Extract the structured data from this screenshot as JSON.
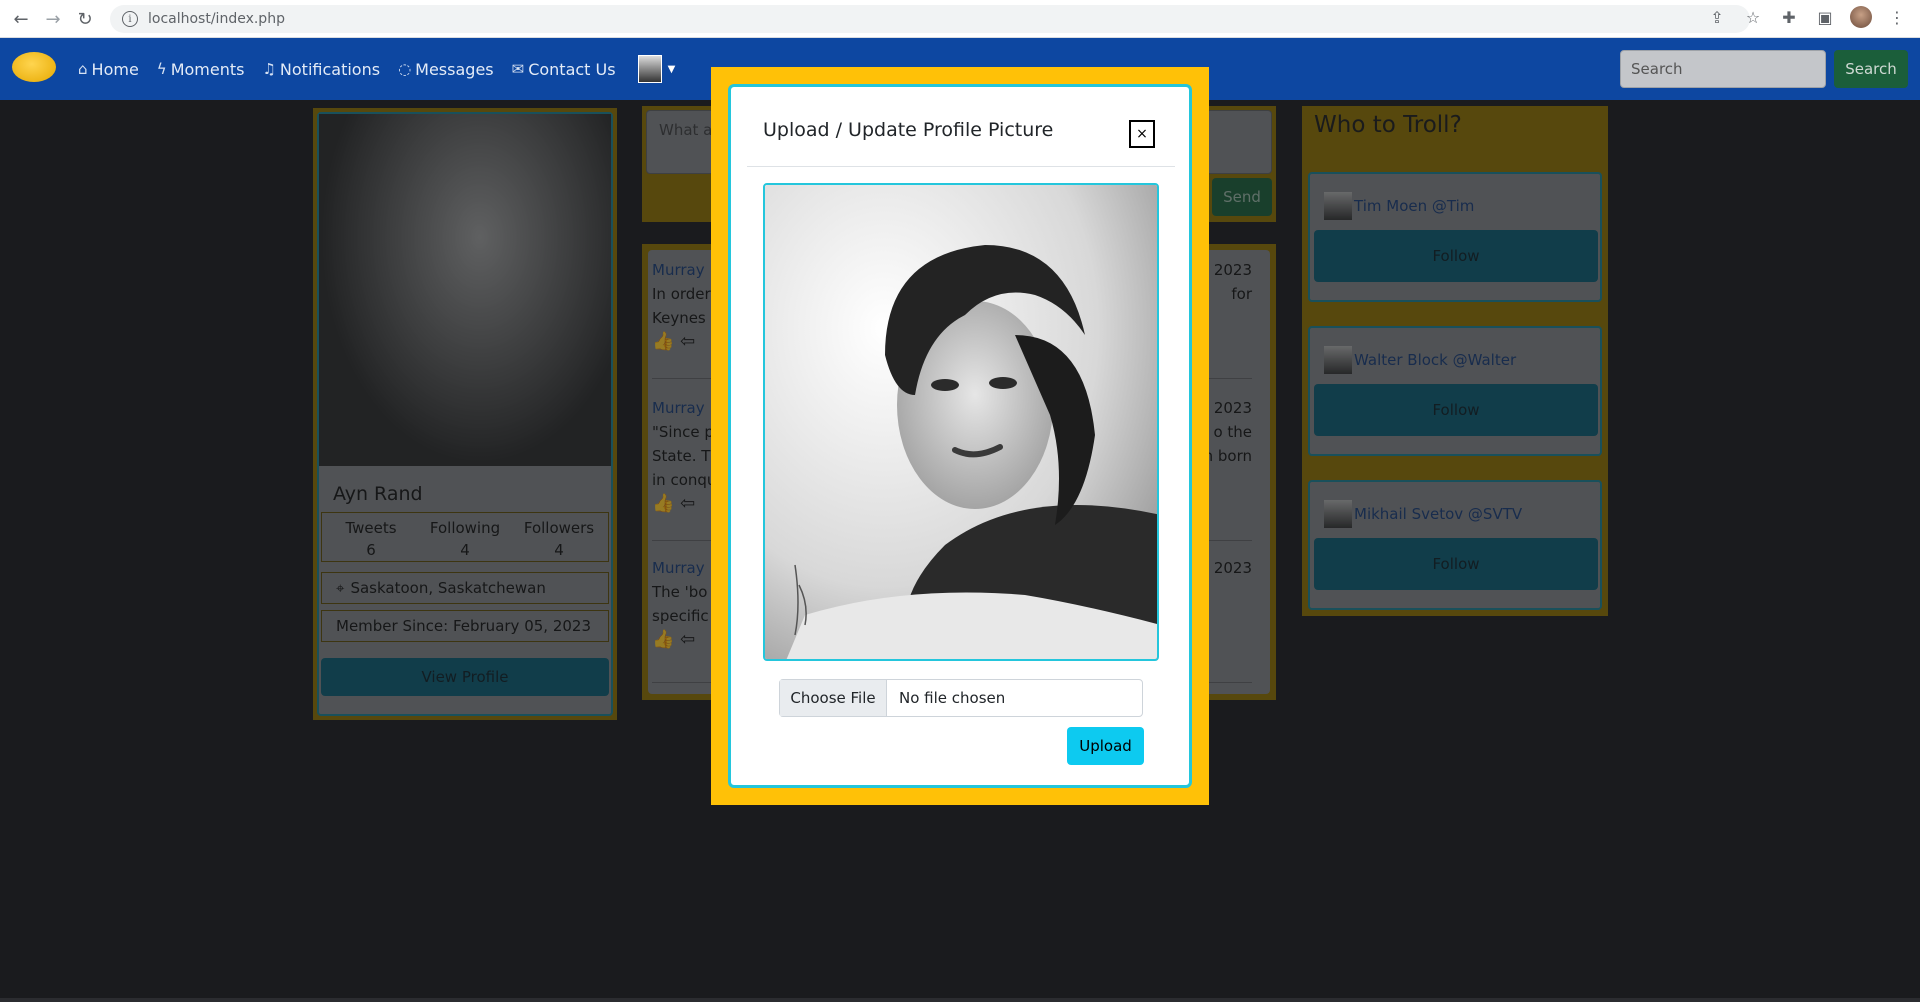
{
  "browser": {
    "url": "localhost/index.php"
  },
  "navbar": {
    "items": [
      {
        "label": "Home",
        "icon": "home-icon"
      },
      {
        "label": "Moments",
        "icon": "lightning-icon"
      },
      {
        "label": "Notifications",
        "icon": "bell-icon"
      },
      {
        "label": "Messages",
        "icon": "chat-icon"
      },
      {
        "label": "Contact Us",
        "icon": "envelope-icon"
      }
    ],
    "search_placeholder": "Search",
    "search_button": "Search"
  },
  "profile": {
    "name": "Ayn Rand",
    "stats": [
      {
        "label": "Tweets",
        "value": "6"
      },
      {
        "label": "Following",
        "value": "4"
      },
      {
        "label": "Followers",
        "value": "4"
      }
    ],
    "location": "Saskatoon, Saskatchewan",
    "member_since": "Member Since: February 05, 2023",
    "view_profile": "View Profile"
  },
  "composer": {
    "placeholder": "What a",
    "send": "Send"
  },
  "feed": [
    {
      "author": "Murray",
      "date": "th 2023",
      "line1": "In order",
      "line1_right": "for",
      "line2": "Keynes"
    },
    {
      "author": "Murray",
      "date": "th 2023",
      "line1": "\"Since p",
      "line1_right": "o the",
      "line2": "State. Th",
      "line2_right": "en born",
      "line3": "in conqu"
    },
    {
      "author": "Murray",
      "date": "th 2023",
      "line1": "The 'bo",
      "line2": "specific"
    }
  ],
  "who_to_troll": {
    "title": "Who to Troll?",
    "users": [
      {
        "name": "Tim Moen @Tim",
        "button": "Follow"
      },
      {
        "name": "Walter Block @Walter",
        "button": "Follow"
      },
      {
        "name": "Mikhail Svetov @SVTV",
        "button": "Follow"
      }
    ]
  },
  "modal": {
    "title": "Upload / Update Profile Picture",
    "close": "×",
    "choose_file": "Choose File",
    "no_file": "No file chosen",
    "upload": "Upload"
  }
}
